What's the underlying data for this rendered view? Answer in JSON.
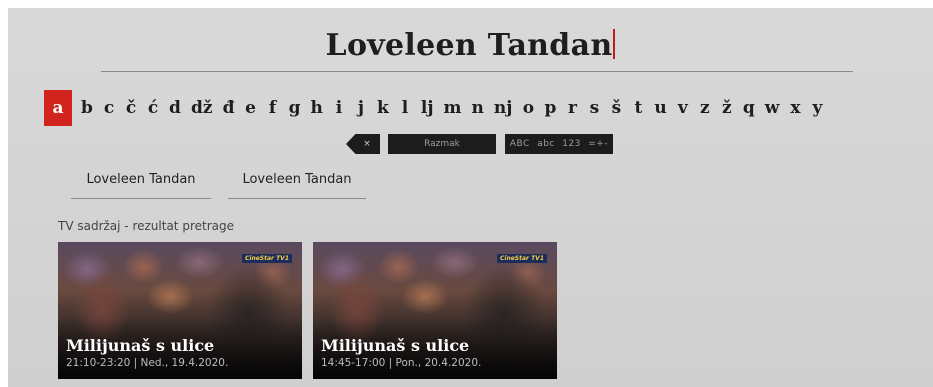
{
  "search": {
    "query": "Loveleen Tandan"
  },
  "keyboard": {
    "selected_index": 0,
    "letters": [
      "a",
      "b",
      "c",
      "č",
      "ć",
      "d",
      "dž",
      "đ",
      "e",
      "f",
      "g",
      "h",
      "i",
      "j",
      "k",
      "l",
      "lj",
      "m",
      "n",
      "nj",
      "o",
      "p",
      "r",
      "s",
      "š",
      "t",
      "u",
      "v",
      "z",
      "ž",
      "q",
      "w",
      "x",
      "y"
    ],
    "backspace_label": "×",
    "space_label": "Razmak",
    "mode_label": "ABC abc 123 =+-"
  },
  "suggestions": [
    "Loveleen Tandan",
    "Loveleen Tandan"
  ],
  "results": {
    "section_title": "TV sadržaj - rezultat pretrage",
    "items": [
      {
        "title": "Milijunaš s ulice",
        "time": "21:10-23:20 | Ned., 19.4.2020.",
        "channel": "CineStar TV1",
        "thumbnail_icon": "program-thumbnail"
      },
      {
        "title": "Milijunaš s ulice",
        "time": "14:45-17:00 | Pon., 20.4.2020.",
        "channel": "CineStar TV1",
        "thumbnail_icon": "program-thumbnail"
      }
    ]
  },
  "colors": {
    "accent": "#d0241c",
    "background": "#d6d6d6",
    "key_dark": "#1c1c1c"
  }
}
